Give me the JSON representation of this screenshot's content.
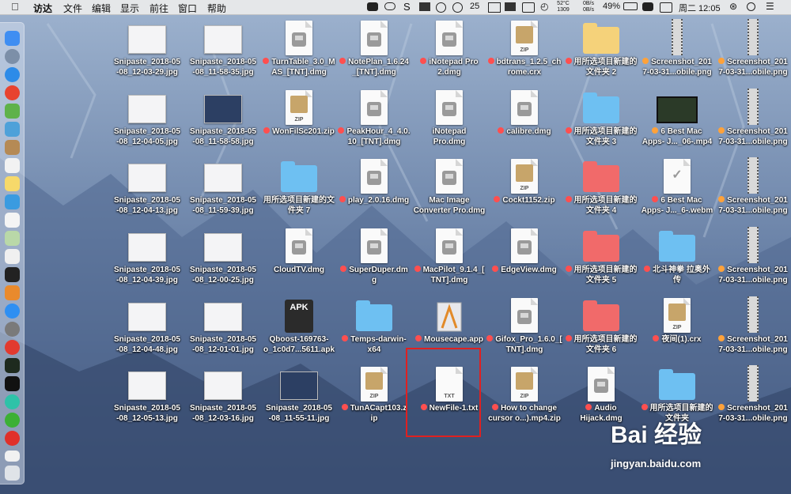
{
  "menubar": {
    "app_name": "访达",
    "menus": [
      "文件",
      "编辑",
      "显示",
      "前往",
      "窗口",
      "帮助"
    ],
    "status": {
      "number_badge": "25",
      "temp": "52°C",
      "rpm": "1309",
      "net_up": "0B/s",
      "net_down": "0B/s",
      "battery": "49%",
      "date_time": "周二 12:05"
    }
  },
  "desktop": {
    "items": [
      {
        "label": "Snipaste_2018-05\n-08_12-03-29.jpg",
        "tag": "",
        "icon": "screenshot-thumb"
      },
      {
        "label": "Snipaste_2018-05\n-08_11-58-35.jpg",
        "tag": "",
        "icon": "screenshot-thumb"
      },
      {
        "label": "TurnTable_3.0_M\nAS_[TNT].dmg",
        "tag": "red",
        "icon": "dmg-icon"
      },
      {
        "label": "NotePlan_1.6.24\n_[TNT].dmg",
        "tag": "red",
        "icon": "dmg-icon"
      },
      {
        "label": "iNotepad Pro\n2.dmg",
        "tag": "red",
        "icon": "dmg-icon"
      },
      {
        "label": "bdtrans_1.2.5_ch\nrome.crx",
        "tag": "red",
        "icon": "zip-icon"
      },
      {
        "label": "用所选项目新建的\n文件夹 2",
        "tag": "red",
        "icon": "folder-yellow"
      },
      {
        "label": "Screenshot_201\n7-03-31...obile.png",
        "tag": "orange",
        "icon": "phone-screenshot"
      },
      {
        "label": "Screenshot_201\n7-03-31...obile.png",
        "tag": "orange",
        "icon": "phone-screenshot"
      },
      {
        "label": "Snipaste_2018-05\n-08_12-04-05.jpg",
        "tag": "",
        "icon": "screenshot-thumb"
      },
      {
        "label": "Snipaste_2018-05\n-08_11-58-58.jpg",
        "tag": "",
        "icon": "screenshot-thumb-dark"
      },
      {
        "label": "WonFilSc201.zip",
        "tag": "red",
        "icon": "zip-icon"
      },
      {
        "label": "PeakHour_4_4.0.\n10_[TNT].dmg",
        "tag": "red",
        "icon": "dmg-icon"
      },
      {
        "label": "iNotepad\nPro.dmg",
        "tag": "",
        "icon": "dmg-icon"
      },
      {
        "label": "calibre.dmg",
        "tag": "red",
        "icon": "dmg-icon"
      },
      {
        "label": "用所选项目新建的\n文件夹 3",
        "tag": "red",
        "icon": "folder-blue"
      },
      {
        "label": "6 Best Mac\nApps- J..._06-.mp4",
        "tag": "orange",
        "icon": "video-thumb"
      },
      {
        "label": "Screenshot_201\n7-03-31...obile.png",
        "tag": "orange",
        "icon": "phone-screenshot"
      },
      {
        "label": "Snipaste_2018-05\n-08_12-04-13.jpg",
        "tag": "",
        "icon": "screenshot-thumb"
      },
      {
        "label": "Snipaste_2018-05\n-08_11-59-39.jpg",
        "tag": "",
        "icon": "screenshot-thumb"
      },
      {
        "label": "用所选项目新建的文\n件夹 7",
        "tag": "",
        "icon": "folder-blue"
      },
      {
        "label": "play_2.0.16.dmg",
        "tag": "red",
        "icon": "dmg-icon"
      },
      {
        "label": "Mac Image\nConverter Pro.dmg",
        "tag": "",
        "icon": "dmg-icon"
      },
      {
        "label": "Cockt1152.zip",
        "tag": "red",
        "icon": "zip-icon"
      },
      {
        "label": "用所选项目新建的\n文件夹 4",
        "tag": "red",
        "icon": "folder-red"
      },
      {
        "label": "6 Best Mac\nApps- J..._6-.webm",
        "tag": "red",
        "icon": "webm-icon"
      },
      {
        "label": "Screenshot_201\n7-03-31...obile.png",
        "tag": "orange",
        "icon": "phone-screenshot"
      },
      {
        "label": "Snipaste_2018-05\n-08_12-04-39.jpg",
        "tag": "",
        "icon": "screenshot-thumb"
      },
      {
        "label": "Snipaste_2018-05\n-08_12-00-25.jpg",
        "tag": "",
        "icon": "screenshot-thumb"
      },
      {
        "label": "CloudTV.dmg",
        "tag": "",
        "icon": "dmg-icon"
      },
      {
        "label": "SuperDuper.dm\ng",
        "tag": "red",
        "icon": "dmg-icon"
      },
      {
        "label": "MacPilot_9.1.4_[\nTNT].dmg",
        "tag": "red",
        "icon": "dmg-icon"
      },
      {
        "label": "EdgeView.dmg",
        "tag": "red",
        "icon": "dmg-icon"
      },
      {
        "label": "用所选项目新建的\n文件夹 5",
        "tag": "red",
        "icon": "folder-red"
      },
      {
        "label": "北斗神拳 拉奥外\n传",
        "tag": "red",
        "icon": "folder-blue"
      },
      {
        "label": "Screenshot_201\n7-03-31...obile.png",
        "tag": "orange",
        "icon": "phone-screenshot"
      },
      {
        "label": "Snipaste_2018-05\n-08_12-04-48.jpg",
        "tag": "",
        "icon": "screenshot-thumb"
      },
      {
        "label": "Snipaste_2018-05\n-08_12-01-01.jpg",
        "tag": "",
        "icon": "screenshot-thumb"
      },
      {
        "label": "Qboost-169763-\no_1c0d7...5611.apk",
        "tag": "",
        "icon": "apk-icon"
      },
      {
        "label": "Temps-darwin-\nx64",
        "tag": "red",
        "icon": "folder-blue"
      },
      {
        "label": "Mousecape.app",
        "tag": "red",
        "icon": "app-icon"
      },
      {
        "label": "Gifox_Pro_1.6.0_[\nTNT].dmg",
        "tag": "red",
        "icon": "dmg-icon"
      },
      {
        "label": "用所选项目新建的\n文件夹 6",
        "tag": "red",
        "icon": "folder-red"
      },
      {
        "label": "夜间(1).crx",
        "tag": "red",
        "icon": "zip-icon"
      },
      {
        "label": "Screenshot_201\n7-03-31...obile.png",
        "tag": "orange",
        "icon": "phone-screenshot"
      },
      {
        "label": "Snipaste_2018-05\n-08_12-05-13.jpg",
        "tag": "",
        "icon": "screenshot-thumb"
      },
      {
        "label": "Snipaste_2018-05\n-08_12-03-16.jpg",
        "tag": "",
        "icon": "screenshot-thumb"
      },
      {
        "label": "Snipaste_2018-05\n-08_11-55-11.jpg",
        "tag": "",
        "icon": "screenshot-thumb-dark"
      },
      {
        "label": "TunACapt103.z\nip",
        "tag": "red",
        "icon": "zip-icon"
      },
      {
        "label": "NewFile-1.txt",
        "tag": "red",
        "icon": "txt-icon"
      },
      {
        "label": "How to change\ncursor o...).mp4.zip",
        "tag": "red",
        "icon": "zip-icon"
      },
      {
        "label": "Audio\nHijack.dmg",
        "tag": "red",
        "icon": "dmg-icon"
      },
      {
        "label": "用所选项目新建的\n文件夹",
        "tag": "red",
        "icon": "folder-blue"
      },
      {
        "label": "Screenshot_201\n7-03-31...obile.png",
        "tag": "orange",
        "icon": "phone-screenshot"
      }
    ]
  },
  "watermark": {
    "brand": "Bai 经验",
    "url": "jingyan.baidu.com"
  },
  "colors": {
    "tag_red": "#ff4f4f",
    "tag_orange": "#ffa23a",
    "highlight_box": "#e02020"
  }
}
